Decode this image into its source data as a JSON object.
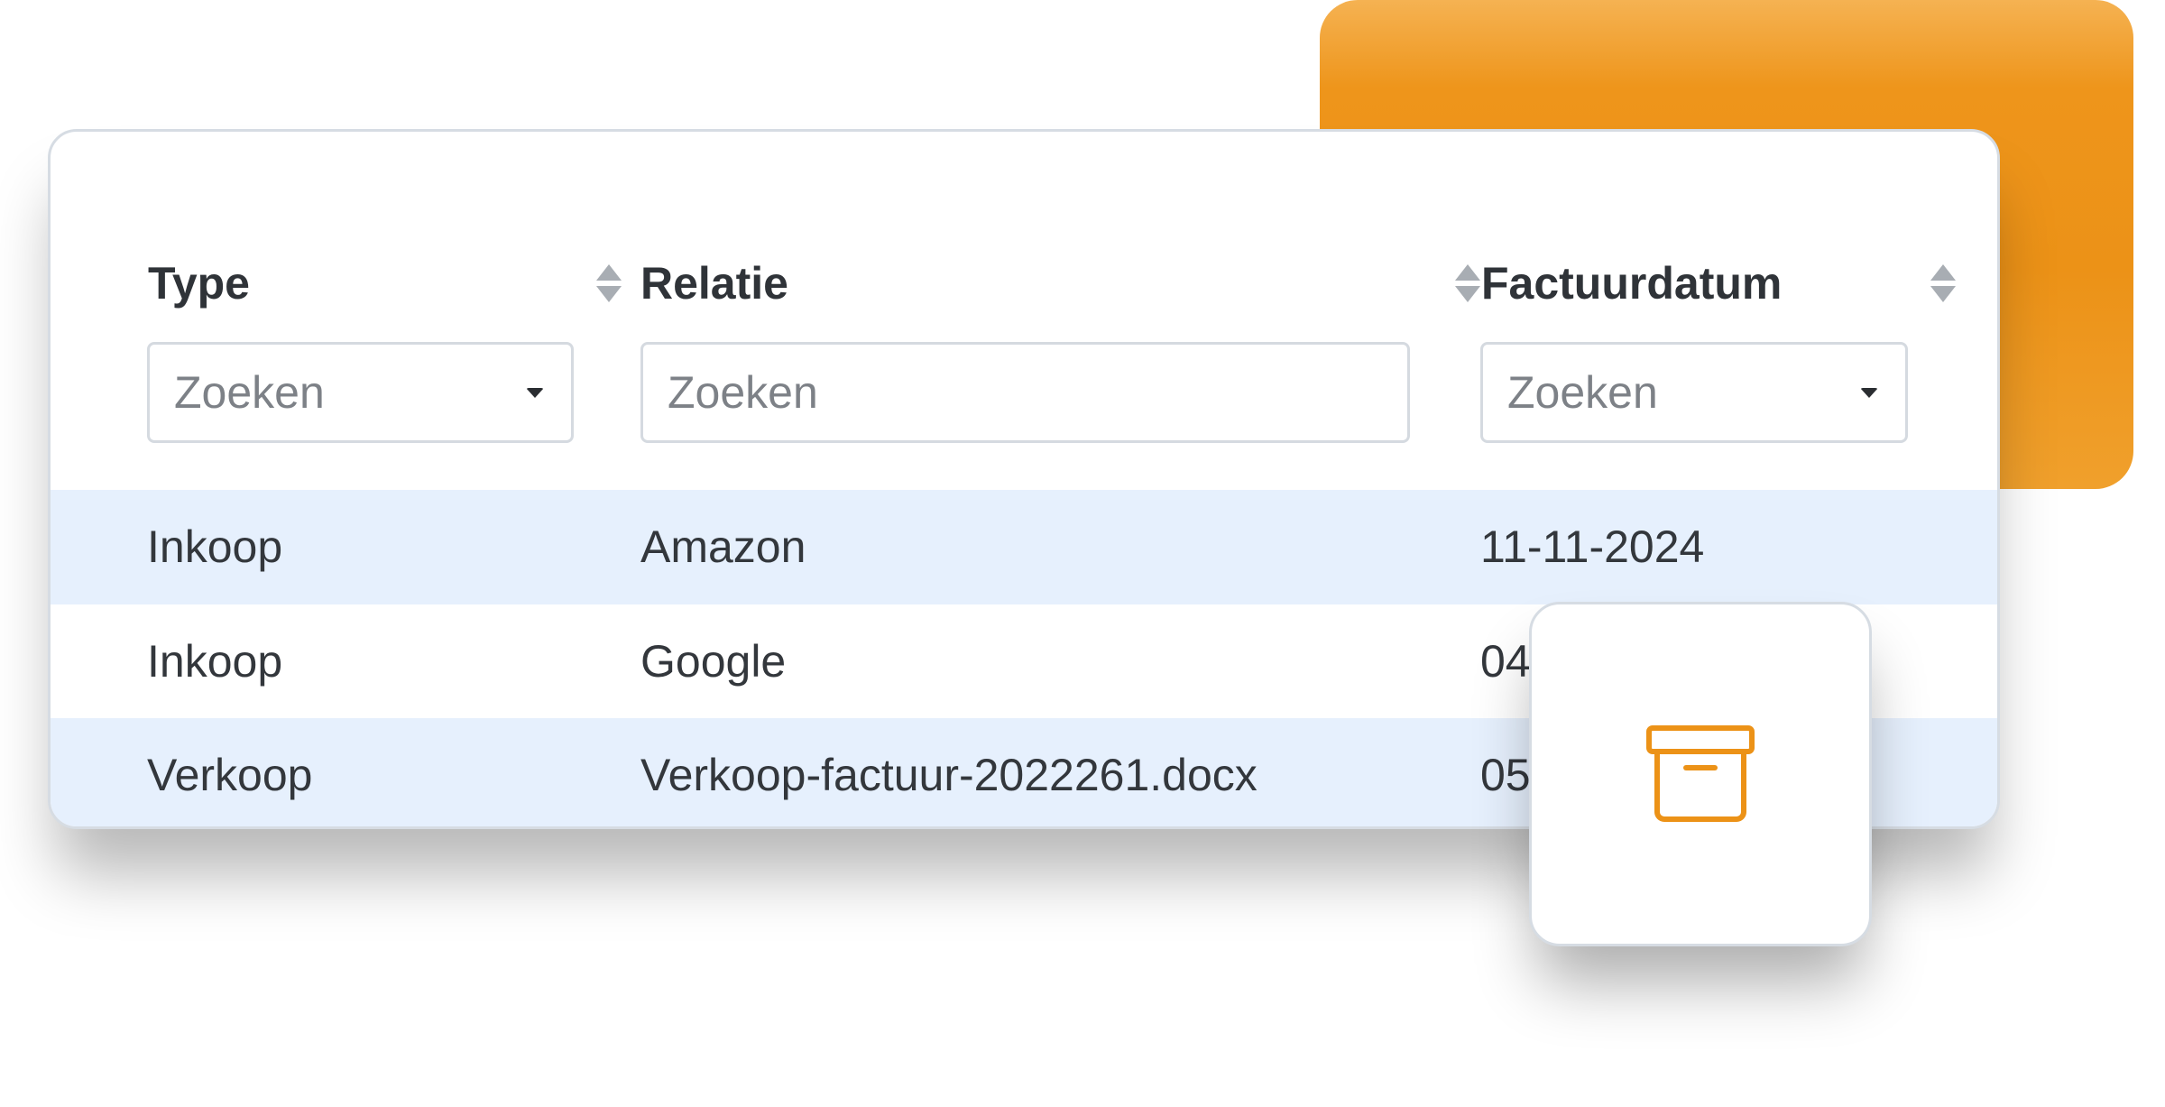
{
  "table": {
    "columns": [
      {
        "title": "Type",
        "filter_placeholder": "Zoeken",
        "filter_kind": "dropdown"
      },
      {
        "title": "Relatie",
        "filter_placeholder": "Zoeken",
        "filter_kind": "text"
      },
      {
        "title": "Factuurdatum",
        "filter_placeholder": "Zoeken",
        "filter_kind": "dropdown"
      }
    ],
    "rows": [
      {
        "type": "Inkoop",
        "relatie": "Amazon",
        "datum": "11-11-2024"
      },
      {
        "type": "Inkoop",
        "relatie": "Google",
        "datum": "04"
      },
      {
        "type": "Verkoop",
        "relatie": "Verkoop-factuur-2022261.docx",
        "datum": "05"
      }
    ]
  },
  "archive_tile": {
    "icon": "archive-icon"
  },
  "colors": {
    "accent": "#ec9217",
    "row_highlight": "#e6f0fd",
    "text": "#33373c",
    "border": "#d6dce3"
  }
}
